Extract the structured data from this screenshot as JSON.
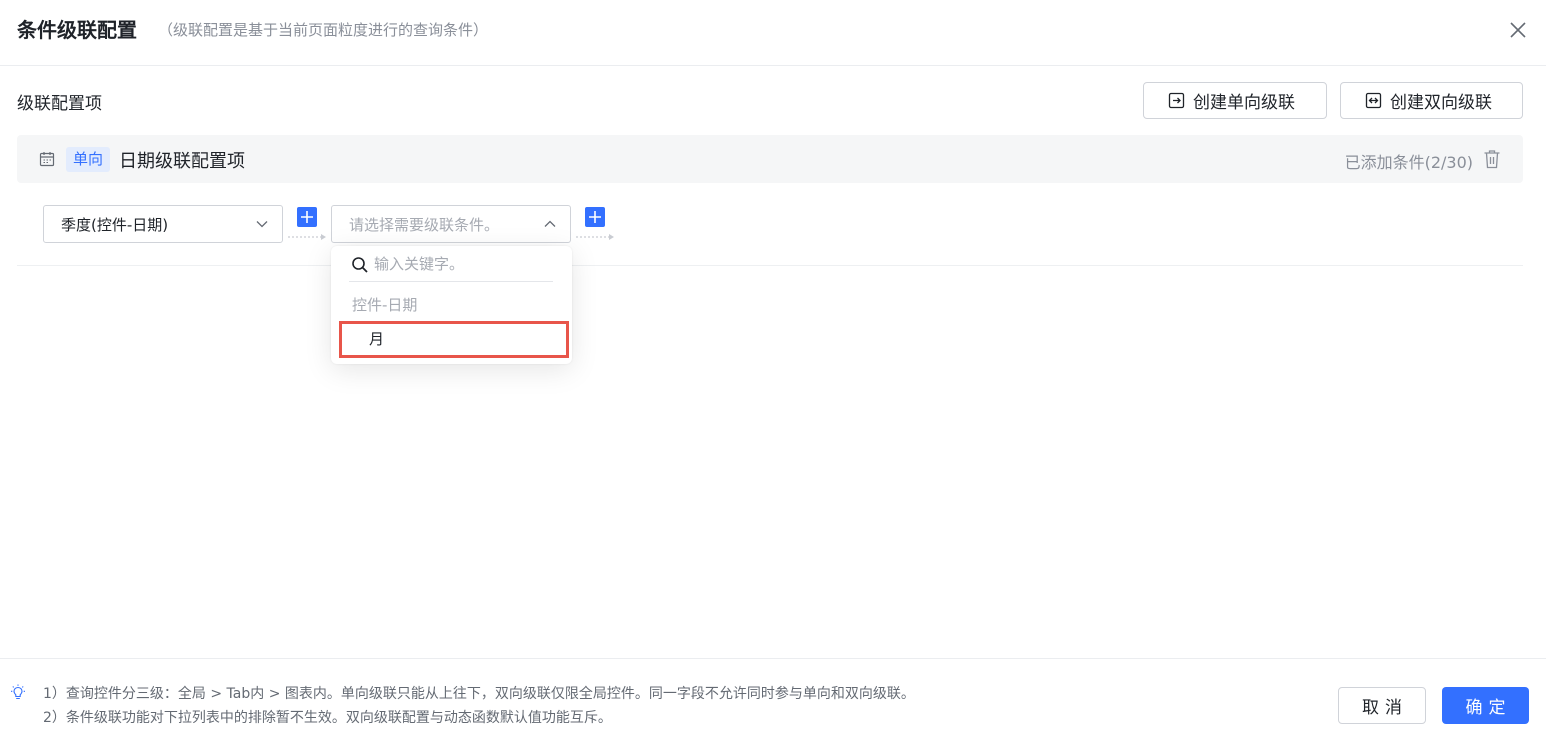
{
  "dialog": {
    "title": "条件级联配置",
    "subtitle": "（级联配置是基于当前页面粒度进行的查询条件）"
  },
  "section": {
    "title": "级联配置项",
    "create_single_label": "创建单向级联",
    "create_double_label": "创建双向级联"
  },
  "item": {
    "tag": "单向",
    "name": "日期级联配置项",
    "added_count": "已添加条件(2/30)"
  },
  "cascade": {
    "first_select_value": "季度(控件-日期)",
    "second_select_placeholder": "请选择需要级联条件。"
  },
  "dropdown": {
    "search_placeholder": "输入关键字。",
    "group_label": "控件-日期",
    "options": [
      "月"
    ]
  },
  "footer": {
    "tip_1": "1）查询控件分三级：全局 > Tab内 > 图表内。单向级联只能从上往下，双向级联仅限全局控件。同一字段不允许同时参与单向和双向级联。",
    "tip_2": "2）条件级联功能对下拉列表中的排除暂不生效。双向级联配置与动态函数默认值功能互斥。",
    "cancel_label": "取消",
    "ok_label": "确定"
  },
  "colors": {
    "primary": "#3370ff",
    "highlight_border": "#e8554a",
    "tag_bg": "#e3ecfd"
  }
}
